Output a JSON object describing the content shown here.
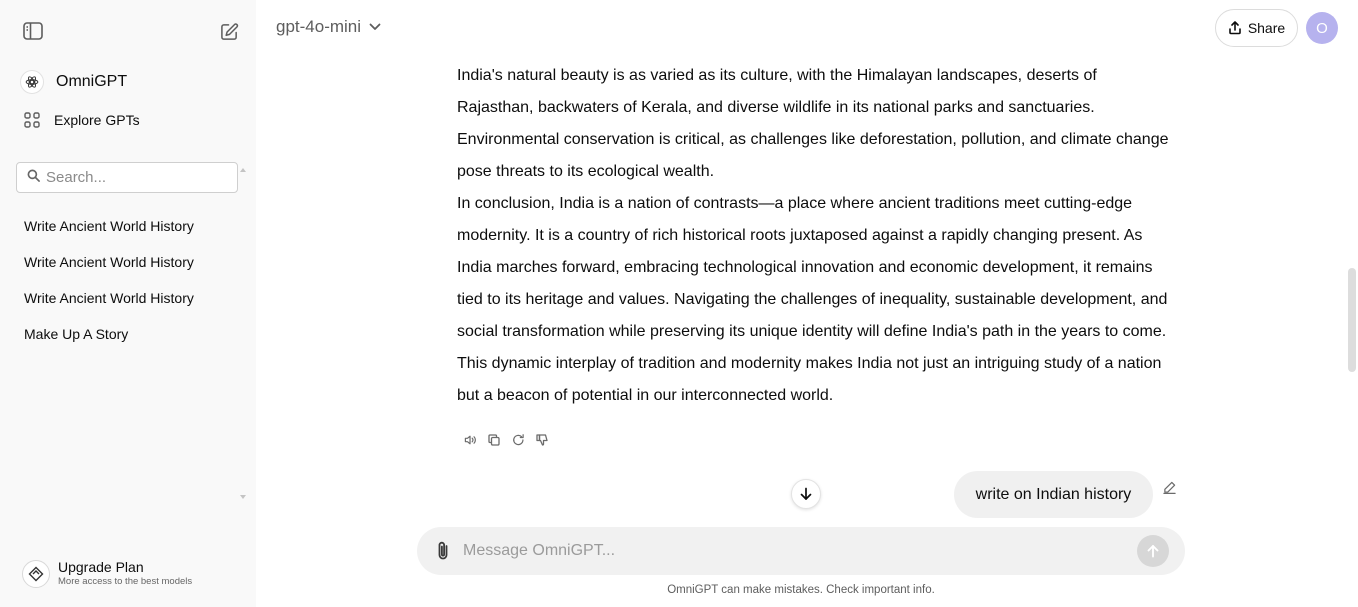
{
  "sidebar": {
    "toggle_icon": "sidebar-toggle-icon",
    "new_chat_icon": "new-chat-icon",
    "brand": {
      "label": "OmniGPT",
      "icon": "openai-logo-icon"
    },
    "explore": {
      "label": "Explore GPTs",
      "icon": "grid-icon"
    },
    "search": {
      "placeholder": "Search...",
      "value": ""
    },
    "history": [
      {
        "label": "Write Ancient World History"
      },
      {
        "label": "Write Ancient World History"
      },
      {
        "label": "Write Ancient World History"
      },
      {
        "label": "Make Up A Story"
      }
    ],
    "upgrade": {
      "title": "Upgrade Plan",
      "subtitle": "More access to the best models"
    }
  },
  "header": {
    "model": "gpt-4o-mini",
    "share_label": "Share",
    "avatar_initial": "O",
    "avatar_color": "#b6b2ee"
  },
  "conversation": {
    "assistant_paragraphs": [
      "India's natural beauty is as varied as its culture, with the Himalayan landscapes, deserts of Rajasthan, backwaters of Kerala, and diverse wildlife in its national parks and sanctuaries. Environmental conservation is critical, as challenges like deforestation, pollution, and climate change pose threats to its ecological wealth.",
      "In conclusion, India is a nation of contrasts—a place where ancient traditions meet cutting-edge modernity. It is a country of rich historical roots juxtaposed against a rapidly changing present. As India marches forward, embracing technological innovation and economic development, it remains tied to its heritage and values. Navigating the challenges of inequality, sustainable development, and social transformation while preserving its unique identity will define India's path in the years to come. This dynamic interplay of tradition and modernity makes India not just an intriguing study of a nation but a beacon of potential in our interconnected world."
    ],
    "message_actions": [
      "speaker-icon",
      "copy-icon",
      "regenerate-icon",
      "thumbs-down-icon"
    ],
    "user_message": "write on Indian history"
  },
  "composer": {
    "placeholder": "Message OmniGPT...",
    "value": ""
  },
  "footer": {
    "disclaimer": "OmniGPT can make mistakes. Check important info."
  }
}
